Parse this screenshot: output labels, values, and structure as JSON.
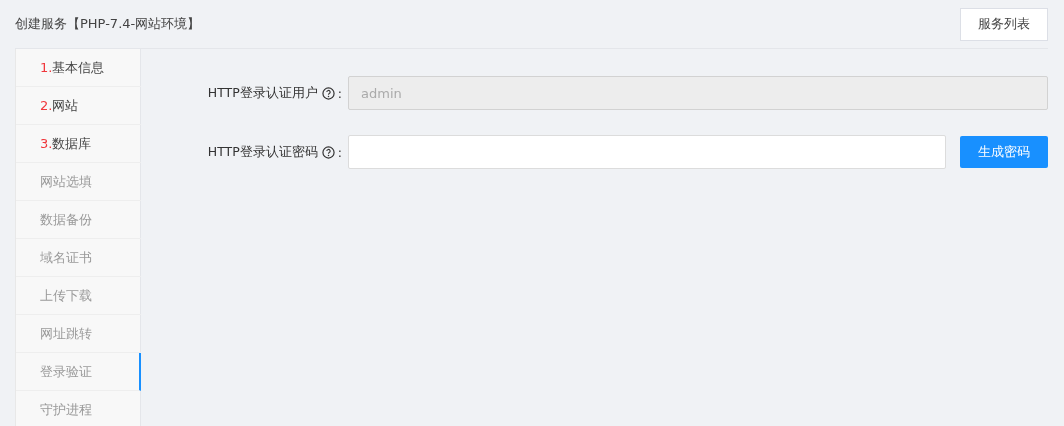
{
  "title": "创建服务【PHP-7.4-网站环境】",
  "header_button": "服务列表",
  "steps": [
    {
      "number": "1.",
      "label": "基本信息",
      "enabled": true,
      "selected": false
    },
    {
      "number": "2.",
      "label": "网站",
      "enabled": true,
      "selected": false
    },
    {
      "number": "3.",
      "label": "数据库",
      "enabled": true,
      "selected": false
    },
    {
      "label": "网站选填",
      "enabled": false,
      "selected": false
    },
    {
      "label": "数据备份",
      "enabled": false,
      "selected": false
    },
    {
      "label": "域名证书",
      "enabled": false,
      "selected": false
    },
    {
      "label": "上传下载",
      "enabled": false,
      "selected": false
    },
    {
      "label": "网址跳转",
      "enabled": false,
      "selected": false
    },
    {
      "label": "登录验证",
      "enabled": false,
      "selected": true
    },
    {
      "label": "守护进程",
      "enabled": false,
      "selected": false
    }
  ],
  "fields": [
    {
      "label": "HTTP登录认证用户",
      "colon": ":",
      "value": "admin",
      "disabled": true
    },
    {
      "label": "HTTP登录认证密码",
      "colon": ":",
      "disabled": false,
      "button": "生成密码"
    }
  ]
}
